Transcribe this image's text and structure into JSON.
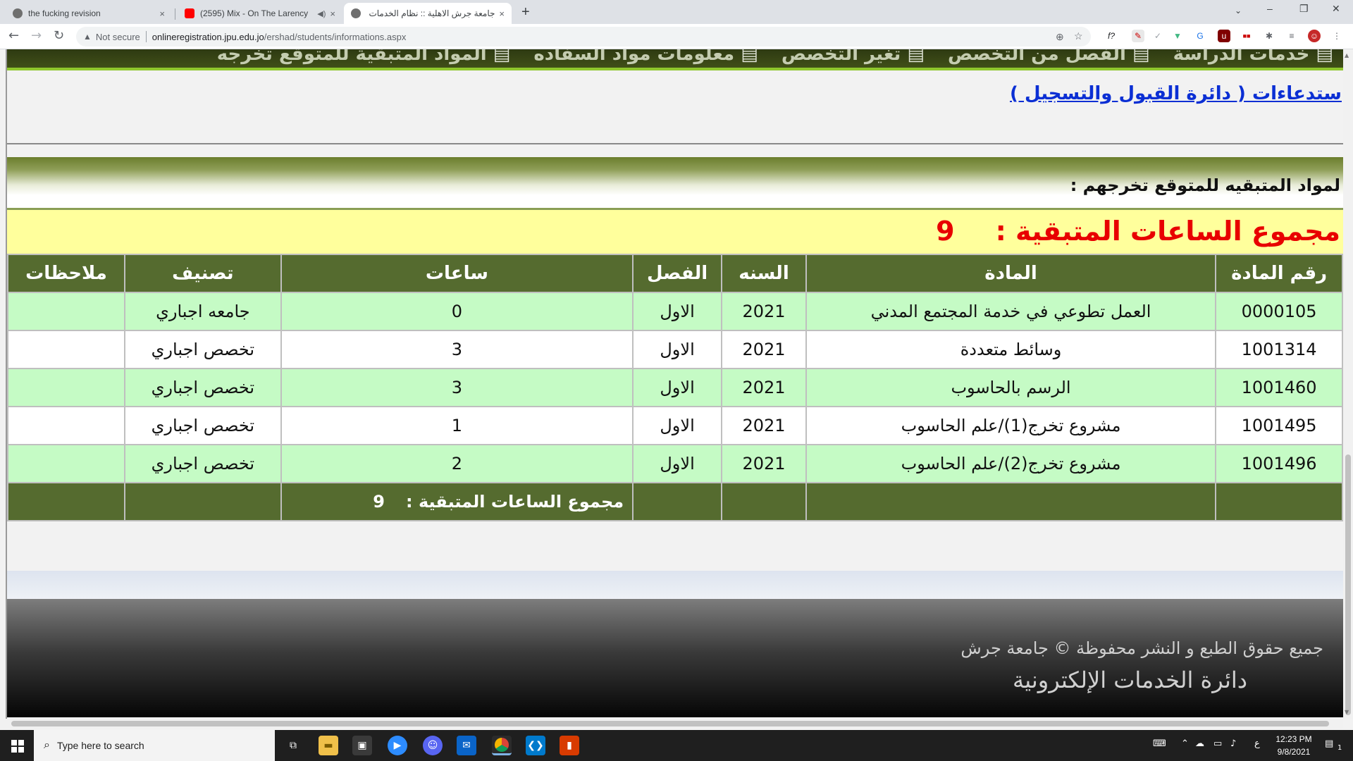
{
  "browser": {
    "tabs": [
      {
        "title": "the fucking revision",
        "close": "×",
        "active": false
      },
      {
        "title": "(2595) Mix - On The Larency",
        "close": "×",
        "active": false,
        "audio": "◀)"
      },
      {
        "title": "جامعة جرش الاهلية :: نظام الخدمات",
        "close": "×",
        "active": true
      }
    ],
    "new_tab": "+",
    "window_controls": {
      "minimize": "–",
      "maximize": "❐",
      "close": "✕"
    },
    "nav": {
      "back": "←",
      "forward": "→",
      "reload": "↻"
    },
    "security_label": "Not secure",
    "url_host": "onlineregistration.jpu.edu.jo",
    "url_path": "/ershad/students/informations.aspx",
    "extension_icons": [
      "zoom-icon",
      "star-icon",
      "fx-icon",
      "eyedropper-icon",
      "check-icon",
      "vue-icon",
      "translate-icon",
      "ublock-icon",
      "extension-icon",
      "puzzle-icon",
      "playlist-icon",
      "profile-icon",
      "menu-icon"
    ]
  },
  "page": {
    "menu_strip": [
      "خدمات الدراسة",
      "الفصل من التخصص",
      "تغير التخصص",
      "معلومات مواد السفاده",
      "المواد المتبقية للمتوقع تخرجه"
    ],
    "link": "ستدعاءات ( دائرة القبول والتسجيل )",
    "section_title": "لمواد المتبقيه للمتوقع تخرجهم :",
    "total_label": "مجموع الساعات المتبقية :",
    "total_value": "9",
    "table": {
      "headers": [
        "رقم المادة",
        "المادة",
        "السنه",
        "الفصل",
        "ساعات",
        "تصنيف",
        "ملاحظات"
      ],
      "rows": [
        {
          "code": "0000105",
          "course": "العمل تطوعي في خدمة المجتمع المدني",
          "year": "2021",
          "semester": "الاول",
          "hours": "0",
          "category": "جامعه اجباري",
          "notes": ""
        },
        {
          "code": "1001314",
          "course": "وسائط متعددة",
          "year": "2021",
          "semester": "الاول",
          "hours": "3",
          "category": "تخصص اجباري",
          "notes": ""
        },
        {
          "code": "1001460",
          "course": "الرسم بالحاسوب",
          "year": "2021",
          "semester": "الاول",
          "hours": "3",
          "category": "تخصص اجباري",
          "notes": ""
        },
        {
          "code": "1001495",
          "course": "مشروع تخرج(1)/علم الحاسوب",
          "year": "2021",
          "semester": "الاول",
          "hours": "1",
          "category": "تخصص اجباري",
          "notes": ""
        },
        {
          "code": "1001496",
          "course": "مشروع تخرج(2)/علم الحاسوب",
          "year": "2021",
          "semester": "الاول",
          "hours": "2",
          "category": "تخصص اجباري",
          "notes": ""
        }
      ],
      "footer_label": "مجموع الساعات المتبقية :",
      "footer_value": "9"
    },
    "footer_copyright": "جميع حقوق الطبع و النشر محفوظة © جامعة جرش",
    "footer_department": "دائرة الخدمات الإلكترونية"
  },
  "taskbar": {
    "search_placeholder": "Type here to search",
    "apps": [
      "task-view-icon",
      "file-explorer-icon",
      "store-icon",
      "zoom-icon",
      "discord-icon",
      "mail-icon",
      "chrome-icon",
      "vscode-icon",
      "office-icon"
    ],
    "time": "12:23 PM",
    "date": "9/8/2021",
    "lang": "ع",
    "notifications": "1"
  },
  "colors": {
    "table_header": "#556b2f",
    "row_alt": "#c5fbc5",
    "total_bar": "#ffff9c",
    "total_text": "#e80000",
    "link": "#0b2fd4"
  }
}
